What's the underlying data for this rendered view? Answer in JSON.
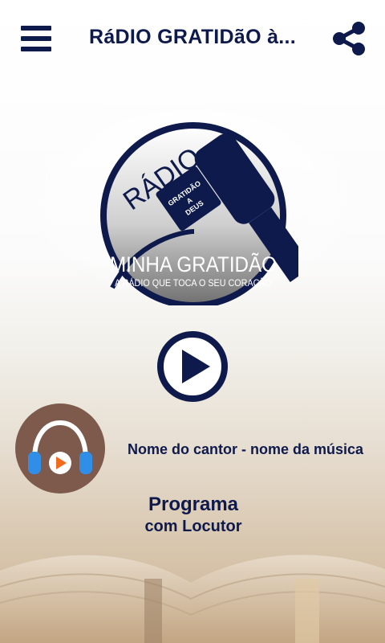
{
  "header": {
    "title": "RáDIO GRATIDãO à...",
    "menu_icon": "hamburger-menu-icon",
    "share_icon": "share-icon"
  },
  "logo": {
    "radio_word": "RÁDIO",
    "mic_badge_line1": "GRATIDÃO",
    "mic_badge_line2": "A",
    "mic_badge_line3": "DEUS",
    "name": "MINHA GRATIDÃO",
    "slogan": "A RÁDIO QUE TOCA O SEU CORAÇÃO"
  },
  "player": {
    "play_icon": "play-circle-icon",
    "now_playing": "Nome do cantor - nome da música",
    "program_line1": "Programa",
    "program_line2": "com Locutor"
  },
  "colors": {
    "primary": "#0e1a4b",
    "avatar_bg": "#7d5a4b",
    "headphone_blue": "#2f8fe8",
    "play_orange": "#f26a1b"
  }
}
